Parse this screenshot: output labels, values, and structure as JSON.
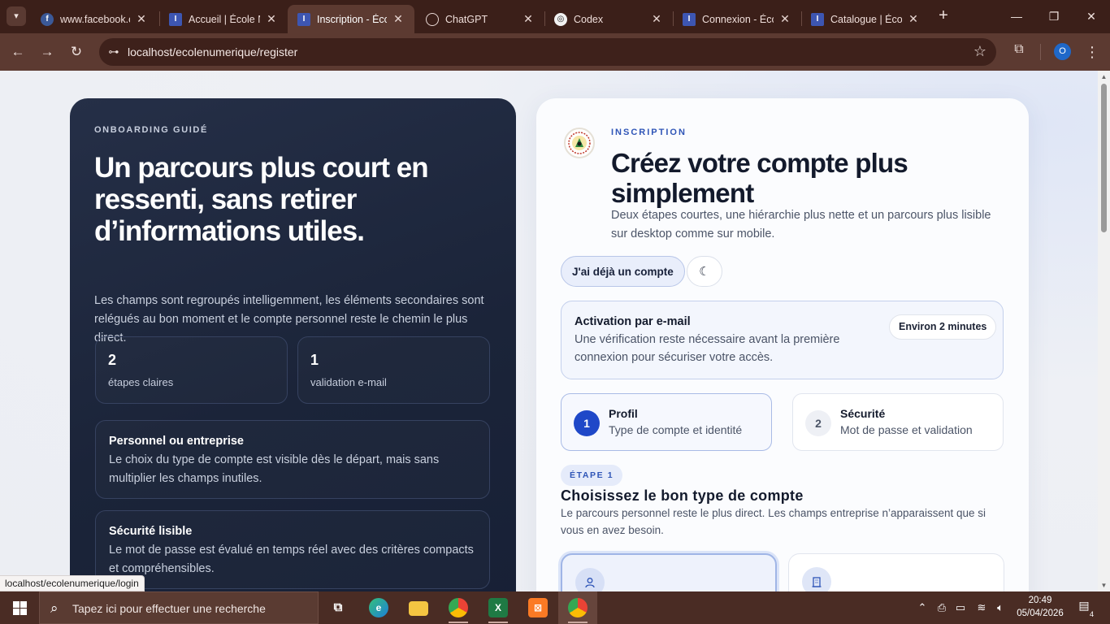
{
  "browser": {
    "tabs": [
      {
        "title": "www.facebook.com",
        "favicon": "facebook-icon",
        "color": "#3b5998"
      },
      {
        "title": "Accueil | École Numérique",
        "favicon": "school-icon",
        "color": "#3d56b2"
      },
      {
        "title": "Inscription - École Numérique",
        "favicon": "school-icon",
        "color": "#3d56b2",
        "active": true
      },
      {
        "title": "ChatGPT",
        "favicon": "openai-icon",
        "color": "#555"
      },
      {
        "title": "Codex",
        "favicon": "codex-icon",
        "color": "#555"
      },
      {
        "title": "Connexion - École Numérique",
        "favicon": "school-icon",
        "color": "#3d56b2"
      },
      {
        "title": "Catalogue | École Numérique",
        "favicon": "school-icon",
        "color": "#3d56b2"
      }
    ],
    "url": "localhost/ecolenumerique/register",
    "profile_initial": "O",
    "hover_link": "localhost/ecolenumerique/login"
  },
  "hero": {
    "eyebrow": "ONBOARDING GUIDÉ",
    "title": "Un parcours plus court en ressenti, sans retirer d’informations utiles.",
    "lead": "Les champs sont regroupés intelligemment, les éléments secondaires sont relégués au bon moment et le compte personnel reste le chemin le plus direct.",
    "stats": [
      {
        "value": "2",
        "label": "étapes claires"
      },
      {
        "value": "1",
        "label": "validation e-mail"
      }
    ],
    "features": [
      {
        "title": "Personnel ou entreprise",
        "desc": "Le choix du type de compte est visible dès le départ, mais sans multiplier les champs inutiles."
      },
      {
        "title": "Sécurité lisible",
        "desc": "Le mot de passe est évalué en temps réel avec des critères compacts et compréhensibles."
      }
    ]
  },
  "form": {
    "eyebrow": "INSCRIPTION",
    "title": "Créez votre compte plus simplement",
    "subtitle": "Deux étapes courtes, une hiérarchie plus nette et un parcours plus lisible sur desktop comme sur mobile.",
    "login_button": "J'ai déjà un compte",
    "theme_icon": "moon-icon",
    "notice": {
      "title": "Activation par e-mail",
      "desc": "Une vérification reste nécessaire avant la première connexion pour sécuriser votre accès.",
      "badge": "Environ 2 minutes"
    },
    "steps": [
      {
        "num": "1",
        "name": "Profil",
        "desc": "Type de compte et identité",
        "active": true
      },
      {
        "num": "2",
        "name": "Sécurité",
        "desc": "Mot de passe et validation",
        "active": false
      }
    ],
    "step_chip": "ÉTAPE 1",
    "section_title": "Choisissez le bon type de compte",
    "section_desc": "Le parcours personnel reste le plus direct. Les champs entreprise n’apparaissent que si vous en avez besoin.",
    "account_types": [
      {
        "icon": "user-icon",
        "selected": true
      },
      {
        "icon": "building-icon",
        "selected": false
      }
    ]
  },
  "taskbar": {
    "search_placeholder": "Tapez ici pour effectuer une recherche",
    "time": "20:49",
    "date": "05/04/2026",
    "notification_count": "4"
  }
}
